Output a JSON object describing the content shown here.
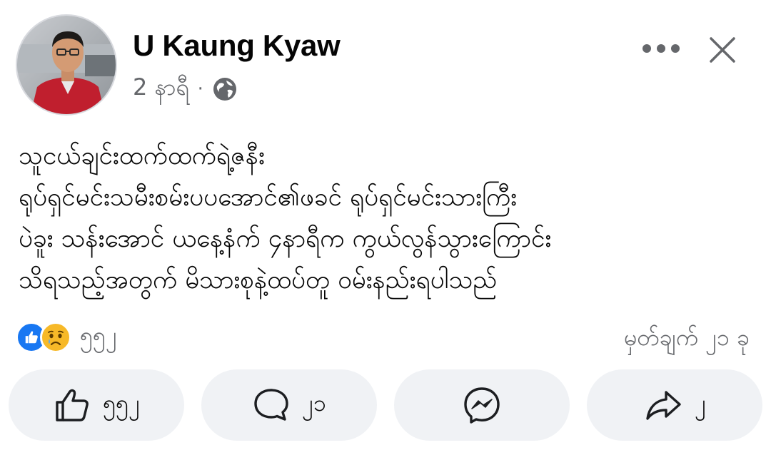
{
  "post": {
    "author": "U Kaung Kyaw",
    "time": "2 နာရီ",
    "separator": "·",
    "privacy_icon": "globe-icon",
    "text_lines": [
      "သူငယ်ချင်းထက်ထက်ရဲ့ဇနီး",
      "ရုပ်ရှင်မင်းသမီးစမ်းပပအောင်၏ဖခင် ရုပ်ရှင်မင်းသားကြီး",
      "ပဲခူး သန်းအောင် ယနေ့နံက် ၄နာရီက ကွယ်လွန်သွားကြောင်း",
      "သိရသည့်အတွက် မိသားစုနဲ့ထပ်တူ ဝမ်းနည်းရပါသည်"
    ]
  },
  "header_actions": {
    "more_icon": "more-horizontal-icon",
    "close_icon": "close-icon"
  },
  "reactions": {
    "icons": [
      "like-reaction-icon",
      "sad-reaction-icon"
    ],
    "count": "၅၅၂",
    "comments_label": "မှတ်ချက် ၂၁ ခု"
  },
  "actions": {
    "like": {
      "icon": "like-icon",
      "count": "၅၅၂"
    },
    "comment": {
      "icon": "comment-icon",
      "count": "၂၁"
    },
    "messenger": {
      "icon": "messenger-icon"
    },
    "share": {
      "icon": "share-icon",
      "count": "၂"
    }
  },
  "colors": {
    "like_blue": "#1877f2",
    "sad_yellow": "#f7b928",
    "secondary_text": "#65676b",
    "button_bg": "#f0f2f5"
  }
}
